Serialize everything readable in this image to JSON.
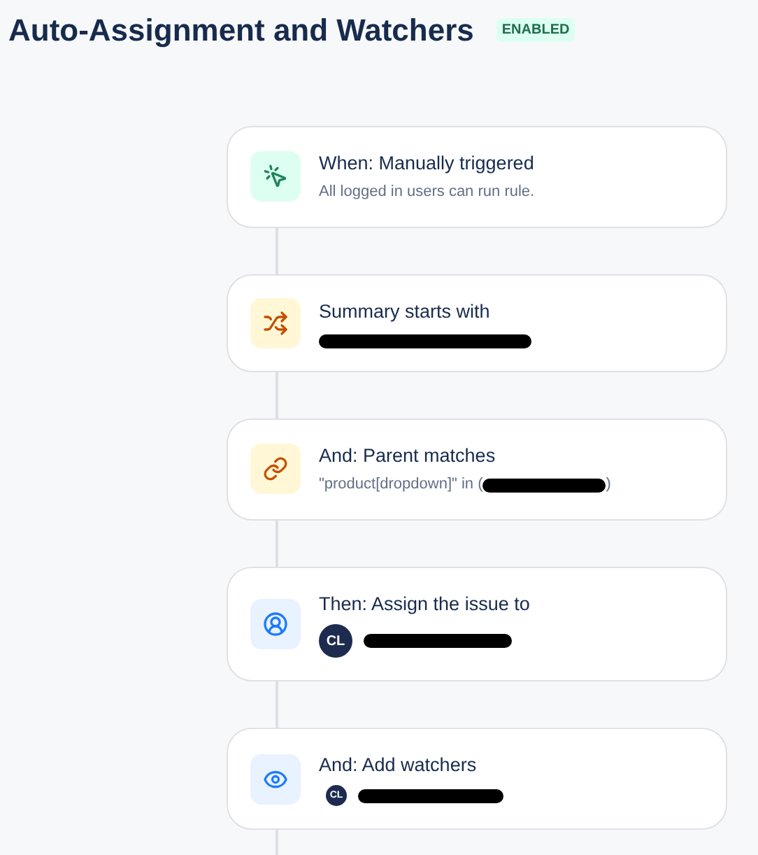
{
  "header": {
    "title": "Auto-Assignment and Watchers",
    "status": "ENABLED"
  },
  "steps": [
    {
      "kind": "trigger",
      "title": "When: Manually triggered",
      "detail": {
        "kind": "text",
        "text": "All logged in users can run rule."
      }
    },
    {
      "kind": "condition",
      "title": "Summary starts with",
      "detail": {
        "kind": "redacted"
      }
    },
    {
      "kind": "branch",
      "title": "And: Parent matches",
      "detail": {
        "kind": "text_redacted",
        "prefix": "\"product[dropdown]\" in (",
        "suffix": ")"
      }
    },
    {
      "kind": "assign",
      "title": "Then: Assign the issue to",
      "detail": {
        "kind": "avatar",
        "initials": "CL"
      }
    },
    {
      "kind": "watch",
      "title": "And: Add watchers",
      "detail": {
        "kind": "minavatar",
        "initials": "CL"
      }
    }
  ]
}
